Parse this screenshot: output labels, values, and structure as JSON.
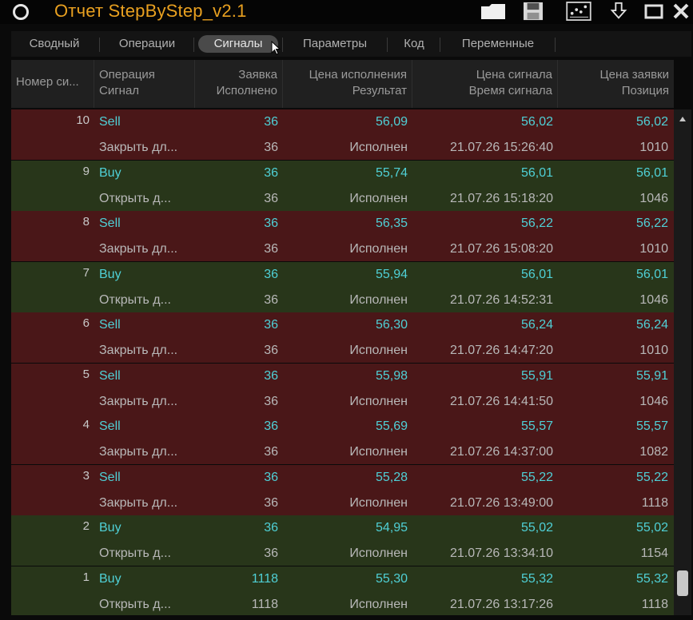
{
  "window": {
    "title": "Отчет StepByStep_v2.1"
  },
  "toolbar": {
    "icons": [
      "folder-icon",
      "save-icon",
      "chart-icon",
      "download-icon",
      "minimize-icon",
      "close-icon"
    ]
  },
  "tabs": [
    {
      "label": "Сводный",
      "active": false
    },
    {
      "label": "Операции",
      "active": false
    },
    {
      "label": "Сигналы",
      "active": true
    },
    {
      "label": "Параметры",
      "active": false
    },
    {
      "label": "Код",
      "active": false
    },
    {
      "label": "Переменные",
      "active": false
    }
  ],
  "table": {
    "columns": [
      {
        "line1": "Номер си...",
        "line2": ""
      },
      {
        "line1": "Операция",
        "line2": "Сигнал"
      },
      {
        "line1": "Заявка",
        "line2": "Исполнено"
      },
      {
        "line1": "Цена исполнения",
        "line2": "Результат"
      },
      {
        "line1": "Цена сигнала",
        "line2": "Время сигнала"
      },
      {
        "line1": "Цена заявки",
        "line2": "Позиция"
      }
    ],
    "rows": [
      {
        "num": "10",
        "signal": "Sell",
        "order": "36",
        "exec_price": "56,09",
        "signal_price": "56,02",
        "order_price": "56,02",
        "operation": "Закрыть дл...",
        "executed": "36",
        "result": "Исполнен",
        "time": "21.07.26 15:26:40",
        "position": "1010"
      },
      {
        "num": "9",
        "signal": "Buy",
        "order": "36",
        "exec_price": "55,74",
        "signal_price": "56,01",
        "order_price": "56,01",
        "operation": "Открыть д...",
        "executed": "36",
        "result": "Исполнен",
        "time": "21.07.26 15:18:20",
        "position": "1046"
      },
      {
        "num": "8",
        "signal": "Sell",
        "order": "36",
        "exec_price": "56,35",
        "signal_price": "56,22",
        "order_price": "56,22",
        "operation": "Закрыть дл...",
        "executed": "36",
        "result": "Исполнен",
        "time": "21.07.26 15:08:20",
        "position": "1010"
      },
      {
        "num": "7",
        "signal": "Buy",
        "order": "36",
        "exec_price": "55,94",
        "signal_price": "56,01",
        "order_price": "56,01",
        "operation": "Открыть д...",
        "executed": "36",
        "result": "Исполнен",
        "time": "21.07.26 14:52:31",
        "position": "1046"
      },
      {
        "num": "6",
        "signal": "Sell",
        "order": "36",
        "exec_price": "56,30",
        "signal_price": "56,24",
        "order_price": "56,24",
        "operation": "Закрыть дл...",
        "executed": "36",
        "result": "Исполнен",
        "time": "21.07.26 14:47:20",
        "position": "1010"
      },
      {
        "num": "5",
        "signal": "Sell",
        "order": "36",
        "exec_price": "55,98",
        "signal_price": "55,91",
        "order_price": "55,91",
        "operation": "Закрыть дл...",
        "executed": "36",
        "result": "Исполнен",
        "time": "21.07.26 14:41:50",
        "position": "1046"
      },
      {
        "num": "4",
        "signal": "Sell",
        "order": "36",
        "exec_price": "55,69",
        "signal_price": "55,57",
        "order_price": "55,57",
        "operation": "Закрыть дл...",
        "executed": "36",
        "result": "Исполнен",
        "time": "21.07.26 14:37:00",
        "position": "1082"
      },
      {
        "num": "3",
        "signal": "Sell",
        "order": "36",
        "exec_price": "55,28",
        "signal_price": "55,22",
        "order_price": "55,22",
        "operation": "Закрыть дл...",
        "executed": "36",
        "result": "Исполнен",
        "time": "21.07.26 13:49:00",
        "position": "1118"
      },
      {
        "num": "2",
        "signal": "Buy",
        "order": "36",
        "exec_price": "54,95",
        "signal_price": "55,02",
        "order_price": "55,02",
        "operation": "Открыть д...",
        "executed": "36",
        "result": "Исполнен",
        "time": "21.07.26 13:34:10",
        "position": "1154"
      },
      {
        "num": "1",
        "signal": "Buy",
        "order": "1118",
        "exec_price": "55,30",
        "signal_price": "55,32",
        "order_price": "55,32",
        "operation": "Открыть д...",
        "executed": "1118",
        "result": "Исполнен",
        "time": "21.07.26 13:17:26",
        "position": "1118"
      }
    ]
  },
  "colors": {
    "title": "#e8a020",
    "sell_row": "#4a1718",
    "buy_row": "#28361a",
    "value_cyan": "#4fd0d6"
  }
}
